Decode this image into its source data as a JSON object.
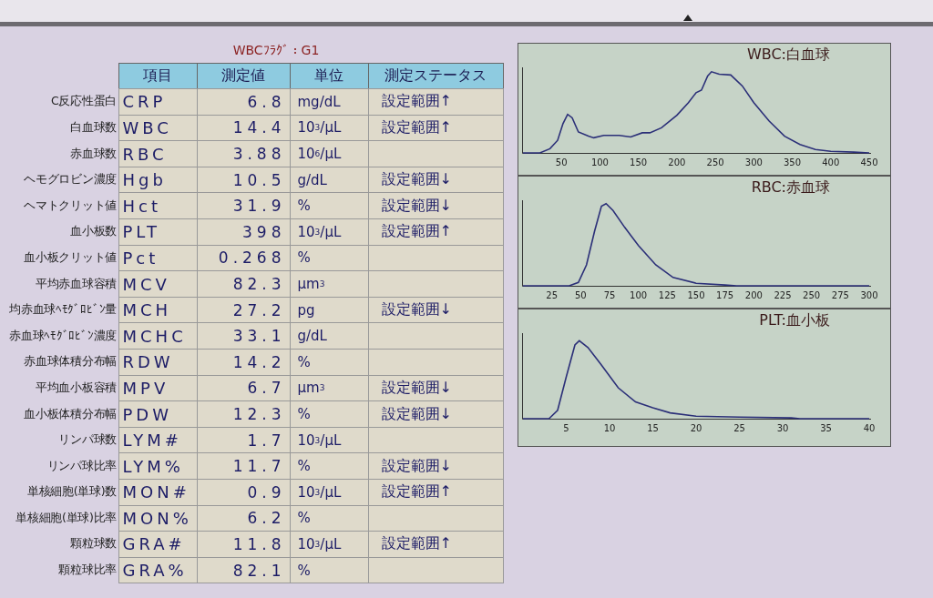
{
  "flag_title": "WBCﾌﾗｸﾞ：G1",
  "table": {
    "columns": [
      "項目",
      "測定値",
      "単位",
      "測定ステータス"
    ],
    "rows": [
      {
        "label": "C反応性蛋白",
        "item": "CRP",
        "value": "6.8",
        "unit": "mg/dL",
        "status": "設定範囲↑"
      },
      {
        "label": "白血球数",
        "item": "WBC",
        "value": "14.4",
        "unit": "10$^{3}$/μL",
        "status": "設定範囲↑"
      },
      {
        "label": "赤血球数",
        "item": "RBC",
        "value": "3.88",
        "unit": "10$^{6}$/μL"
      },
      {
        "label": "ヘモグロビン濃度",
        "item": "Hgb",
        "value": "10.5",
        "unit": "g/dL",
        "status": "設定範囲↓"
      },
      {
        "label": "ヘマトクリット値",
        "item": "Hct",
        "value": "31.9",
        "unit": "%",
        "status": "設定範囲↓"
      },
      {
        "label": "血小板数",
        "item": "PLT",
        "value": "398",
        "unit": "10$^{3}$/μL",
        "status": "設定範囲↑"
      },
      {
        "label": "血小板クリット値",
        "item": "Pct",
        "value": "0.268",
        "unit": "%"
      },
      {
        "label": "平均赤血球容積",
        "item": "MCV",
        "value": "82.3",
        "unit": "μm$^{3}$"
      },
      {
        "label": "均赤血球ﾍﾓｸﾞﾛﾋﾞﾝ量",
        "item": "MCH",
        "value": "27.2",
        "unit": "pg",
        "status": "設定範囲↓"
      },
      {
        "label": "赤血球ﾍﾓｸﾞﾛﾋﾞﾝ濃度",
        "item": "MCHC",
        "value": "33.1",
        "unit": "g/dL"
      },
      {
        "label": "赤血球体積分布幅",
        "item": "RDW",
        "value": "14.2",
        "unit": "%"
      },
      {
        "label": "平均血小板容積",
        "item": "MPV",
        "value": "6.7",
        "unit": "μm$^{3}$",
        "status": "設定範囲↓"
      },
      {
        "label": "血小板体積分布幅",
        "item": "PDW",
        "value": "12.3",
        "unit": "%",
        "status": "設定範囲↓"
      },
      {
        "label": "リンパ球数",
        "item": "LYM#",
        "value": "1.7",
        "unit": "10$^{3}$/μL"
      },
      {
        "label": "リンパ球比率",
        "item": "LYM%",
        "value": "11.7",
        "unit": "%",
        "status": "設定範囲↓"
      },
      {
        "label": "単核細胞(単球)数",
        "item": "MON#",
        "value": "0.9",
        "unit": "10$^{3}$/μL",
        "status": "設定範囲↑"
      },
      {
        "label": "単核細胞(単球)比率",
        "item": "MON%",
        "value": "6.2",
        "unit": "%"
      },
      {
        "label": "顆粒球数",
        "item": "GRA#",
        "value": "11.8",
        "unit": "10$^{3}$/μL",
        "status": "設定範囲↑"
      },
      {
        "label": "顆粒球比率",
        "item": "GRA%",
        "value": "82.1",
        "unit": "%"
      }
    ]
  },
  "histograms": [
    {
      "title": "WBC:白血球",
      "x_ticks": [
        "50",
        "100",
        "150",
        "200",
        "250",
        "300",
        "350",
        "400",
        "450"
      ]
    },
    {
      "title": "RBC:赤血球",
      "x_ticks": [
        "25",
        "50",
        "75",
        "100",
        "125",
        "150",
        "175",
        "200",
        "225",
        "250",
        "275",
        "300"
      ]
    },
    {
      "title": "PLT:血小板",
      "x_ticks": [
        "5",
        "10",
        "15",
        "20",
        "25",
        "30",
        "35",
        "40"
      ]
    }
  ]
}
